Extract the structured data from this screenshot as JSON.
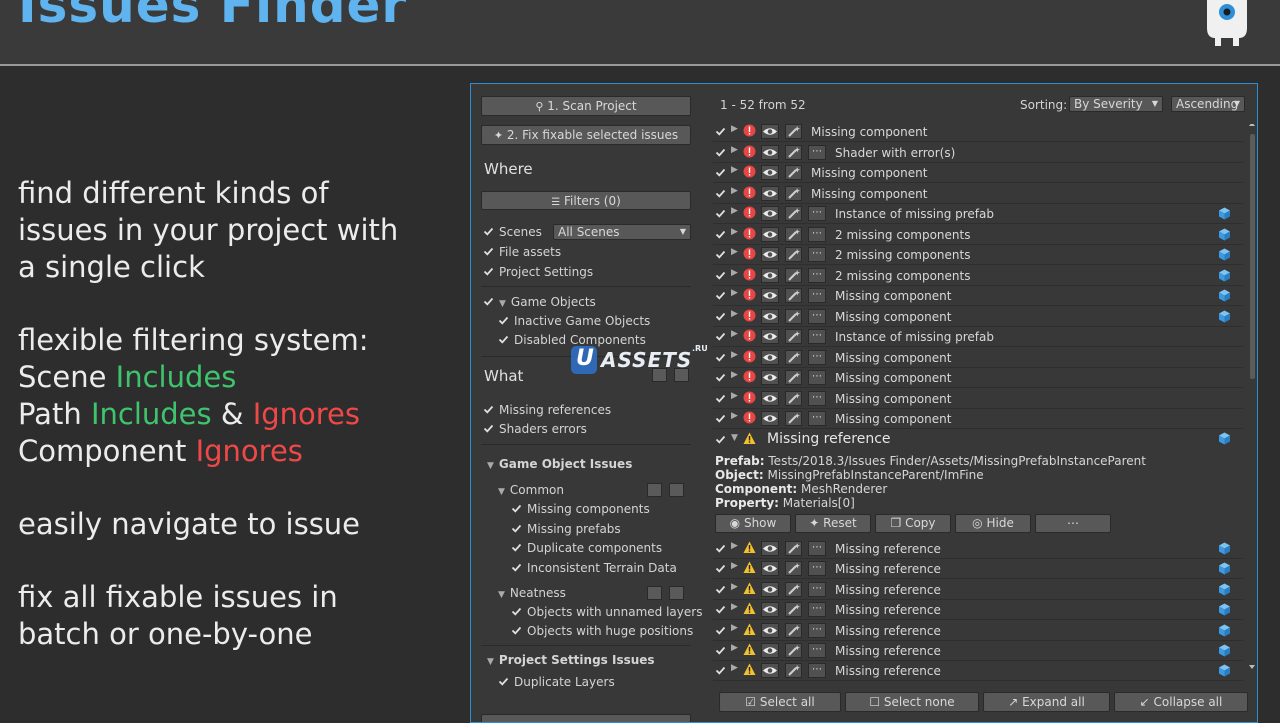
{
  "header": {
    "title": "Issues Finder"
  },
  "left_text": {
    "line1": "find different kinds of",
    "line2": "issues in your project with",
    "line3": "a single click",
    "filter_title": "flexible filtering system:",
    "scene_label": "Scene",
    "includes": "Includes",
    "path_label": "Path",
    "amp": "&",
    "ignores": "Ignores",
    "component_label": "Component",
    "navigate": "easily navigate to issue",
    "fix1": "fix all fixable issues in",
    "fix2": "batch or one-by-one"
  },
  "left_panel": {
    "scan_button": "1. Scan Project",
    "fix_button": "2. Fix fixable selected issues",
    "where_title": "Where",
    "filters_button": "Filters (0)",
    "scenes_label": "Scenes",
    "scenes_select": "All Scenes",
    "file_assets": "File assets",
    "project_settings": "Project Settings",
    "game_objects": "Game Objects",
    "inactive_game_objects": "Inactive Game Objects",
    "disabled_components": "Disabled Components",
    "what_title": "What",
    "missing_references": "Missing references",
    "shaders_errors": "Shaders errors",
    "game_object_issues": "Game Object Issues",
    "common": "Common",
    "missing_components": "Missing components",
    "missing_prefabs": "Missing prefabs",
    "duplicate_components": "Duplicate components",
    "inconsistent_terrain": "Inconsistent Terrain Data",
    "neatness": "Neatness",
    "unnamed_layers": "Objects with unnamed layers",
    "huge_positions": "Objects with huge positions",
    "project_settings_issues": "Project Settings Issues",
    "duplicate_layers": "Duplicate Layers"
  },
  "results": {
    "count": "1 - 52 from 52",
    "sorting_label": "Sorting:",
    "sort_by": "By Severity",
    "sort_order": "Ascending",
    "rows_top": [
      {
        "label": "Missing component",
        "severity": "error",
        "has_more": false,
        "cube": false
      },
      {
        "label": "Shader with error(s)",
        "severity": "error",
        "has_more": true,
        "cube": false
      },
      {
        "label": "Missing component",
        "severity": "error",
        "has_more": false,
        "cube": false
      },
      {
        "label": "Missing component",
        "severity": "error",
        "has_more": false,
        "cube": false
      },
      {
        "label": "Instance of missing prefab",
        "severity": "error",
        "has_more": true,
        "cube": true
      },
      {
        "label": "2 missing components",
        "severity": "error",
        "has_more": true,
        "cube": true
      },
      {
        "label": "2 missing components",
        "severity": "error",
        "has_more": true,
        "cube": true
      },
      {
        "label": "2 missing components",
        "severity": "error",
        "has_more": true,
        "cube": true
      },
      {
        "label": "Missing component",
        "severity": "error",
        "has_more": true,
        "cube": true
      },
      {
        "label": "Missing component",
        "severity": "error",
        "has_more": true,
        "cube": true
      },
      {
        "label": "Instance of missing prefab",
        "severity": "error",
        "has_more": true,
        "cube": false
      },
      {
        "label": "Missing component",
        "severity": "error",
        "has_more": true,
        "cube": false
      },
      {
        "label": "Missing component",
        "severity": "error",
        "has_more": true,
        "cube": false
      },
      {
        "label": "Missing component",
        "severity": "error",
        "has_more": true,
        "cube": false
      },
      {
        "label": "Missing component",
        "severity": "error",
        "has_more": true,
        "cube": false
      }
    ],
    "expanded": {
      "title": "Missing reference",
      "prefab_key": "Prefab:",
      "prefab_val": "Tests/2018.3/Issues Finder/Assets/MissingPrefabInstanceParent",
      "object_key": "Object:",
      "object_val": "MissingPrefabInstanceParent/ImFine",
      "component_key": "Component:",
      "component_val": "MeshRenderer",
      "property_key": "Property:",
      "property_val": "Materials[0]",
      "show": "Show",
      "reset": "Reset",
      "copy": "Copy",
      "hide": "Hide",
      "more": "⋯"
    },
    "rows_bottom": [
      {
        "label": "Missing reference"
      },
      {
        "label": "Missing reference"
      },
      {
        "label": "Missing reference"
      },
      {
        "label": "Missing reference"
      },
      {
        "label": "Missing reference"
      },
      {
        "label": "Missing reference"
      },
      {
        "label": "Missing reference"
      }
    ],
    "select_all": "Select all",
    "select_none": "Select none",
    "expand_all": "Expand all",
    "collapse_all": "Collapse all"
  },
  "watermark": {
    "brand": "ASSETS",
    "letter": "U",
    "suffix": ".RU"
  },
  "colors": {
    "accent": "#5fb4f0",
    "green": "#3ec46d",
    "red": "#ee4848",
    "error": "#e84545",
    "warning": "#f2c12e",
    "cube": "#4aa8e8"
  }
}
